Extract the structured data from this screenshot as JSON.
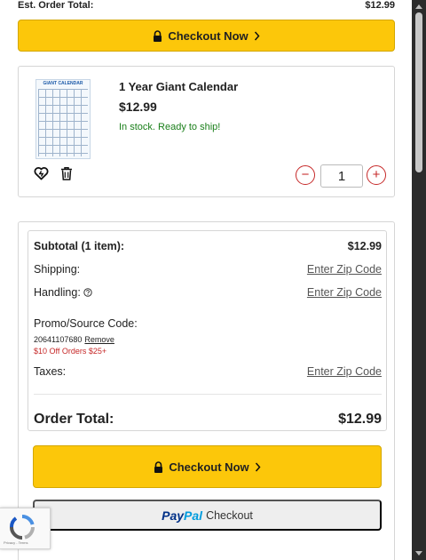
{
  "header": {
    "est_label": "Est. Order Total:",
    "est_value": "$12.99",
    "checkout_label": "Checkout Now"
  },
  "item": {
    "title": "1 Year Giant Calendar",
    "price": "$12.99",
    "stock": "In stock. Ready to ship!",
    "thumb_heading": "GIANT CALENDAR",
    "quantity": "1",
    "minus_label": "−",
    "plus_label": "+"
  },
  "summary": {
    "subtotal_label": "Subtotal (1 item):",
    "subtotal_value": "$12.99",
    "shipping_label": "Shipping:",
    "shipping_value": "Enter Zip Code",
    "handling_label": "Handling:",
    "handling_value": "Enter Zip Code",
    "promo_label": "Promo/Source Code:",
    "promo_code": "20641107680",
    "promo_remove": "Remove",
    "promo_desc": "$10 Off Orders $25+",
    "taxes_label": "Taxes:",
    "taxes_value": "Enter Zip Code",
    "total_label": "Order Total:",
    "total_value": "$12.99",
    "checkout_label": "Checkout Now",
    "paypal_a": "Pay",
    "paypal_b": "Pal",
    "paypal_checkout": "Checkout"
  },
  "recaptcha": {
    "text": "Privacy - Terms"
  },
  "colors": {
    "checkout_yellow": "#fcc70a",
    "in_stock_green": "#1a7f1a",
    "promo_red": "#c62828",
    "paypal_dark": "#003087",
    "paypal_light": "#009cde"
  }
}
